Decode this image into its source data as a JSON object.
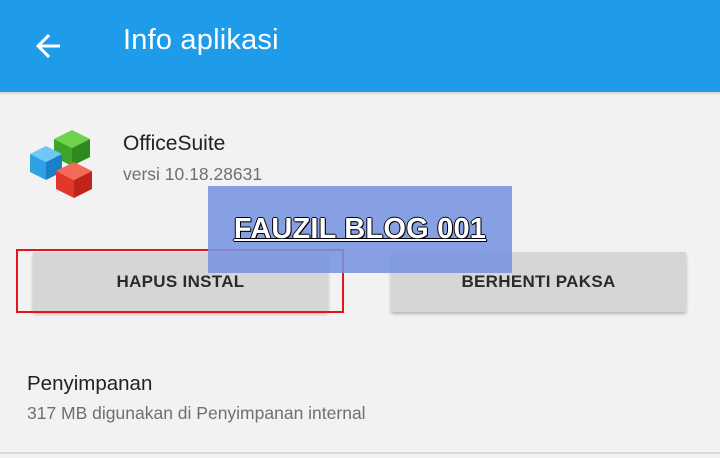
{
  "appbar": {
    "title": "Info aplikasi",
    "back_icon": "arrow-left-icon",
    "color": "#1e9be9"
  },
  "app": {
    "name": "OfficeSuite",
    "version": "versi 10.18.28631",
    "icon": "officesuite-cubes-icon"
  },
  "buttons": {
    "uninstall_label": "HAPUS INSTAL",
    "force_stop_label": "BERHENTI PAKSA"
  },
  "watermark": {
    "text": "FAUZIL BLOG 001"
  },
  "storage": {
    "title": "Penyimpanan",
    "summary": "317 MB digunakan di Penyimpanan internal"
  },
  "colors": {
    "highlight_border": "#e4141b",
    "button_bg": "#d6d6d6"
  }
}
